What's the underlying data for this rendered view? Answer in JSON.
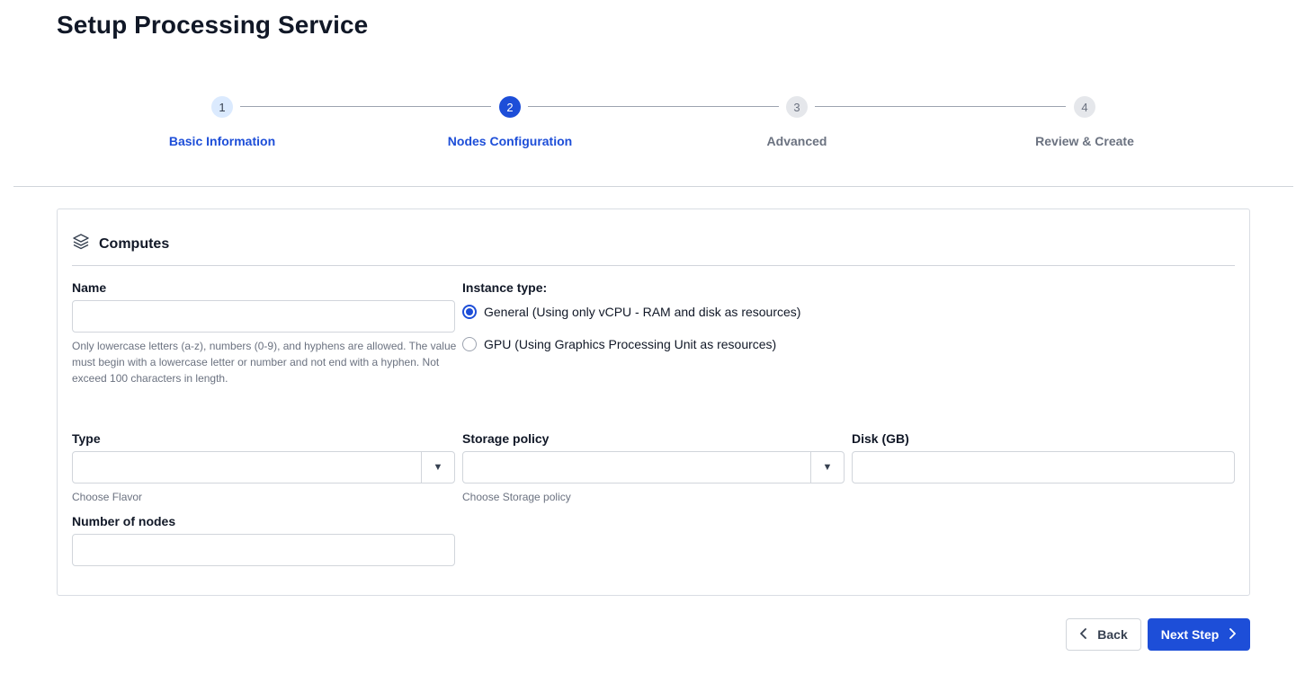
{
  "page": {
    "title": "Setup Processing Service"
  },
  "stepper": {
    "steps": [
      {
        "number": "1",
        "label": "Basic Information",
        "state": "completed"
      },
      {
        "number": "2",
        "label": "Nodes Configuration",
        "state": "active"
      },
      {
        "number": "3",
        "label": "Advanced",
        "state": "upcoming"
      },
      {
        "number": "4",
        "label": "Review & Create",
        "state": "upcoming"
      }
    ]
  },
  "computes": {
    "title": "Computes",
    "icon": "layers-icon",
    "name": {
      "label": "Name",
      "value": "",
      "placeholder": "",
      "help": "Only lowercase letters (a-z), numbers (0-9), and hyphens are allowed. The value must begin with a lowercase letter or number and not end with a hyphen. Not exceed 100 characters in length."
    },
    "instance_type": {
      "label": "Instance type:",
      "options": [
        {
          "label": "General (Using only vCPU - RAM and disk as resources)",
          "checked": true
        },
        {
          "label": "GPU (Using Graphics Processing Unit as resources)",
          "checked": false
        }
      ]
    },
    "type": {
      "label": "Type",
      "value": "",
      "help": "Choose Flavor"
    },
    "storage_policy": {
      "label": "Storage policy",
      "value": "",
      "help": "Choose Storage policy"
    },
    "disk": {
      "label": "Disk (GB)",
      "value": ""
    },
    "nodes": {
      "label": "Number of nodes",
      "value": ""
    }
  },
  "footer": {
    "back_label": "Back",
    "next_label": "Next Step"
  },
  "colors": {
    "primary": "#1d4ed8",
    "border": "#d1d5db",
    "muted_text": "#6b7280"
  }
}
